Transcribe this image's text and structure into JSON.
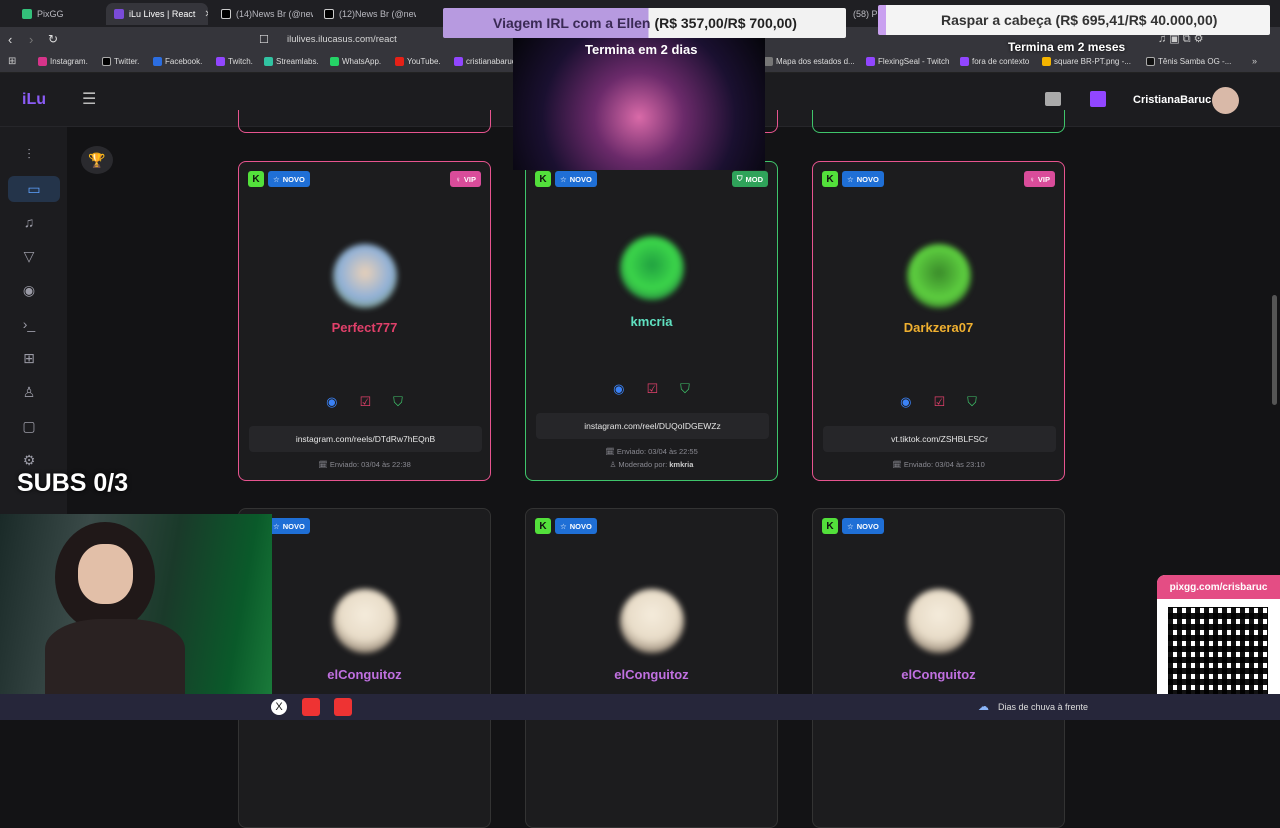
{
  "browser": {
    "tabs": [
      {
        "label": "PixGG",
        "color": "#33c07a"
      },
      {
        "label": "iLu Lives | React",
        "color": "#7a4bd8",
        "active": true
      },
      {
        "label": "(14)News Br (@new",
        "color": "#111"
      },
      {
        "label": "(12)News Br (@new",
        "color": "#111"
      },
      {
        "label": "(58) Pi",
        "color": "#c33"
      }
    ],
    "url": "ilulives.ilucasus.com/react",
    "bookmarks": [
      {
        "label": "Instagram.",
        "color": "#d6348a"
      },
      {
        "label": "Twitter.",
        "color": "#000"
      },
      {
        "label": "Facebook.",
        "color": "#2b6de0"
      },
      {
        "label": "Twitch.",
        "color": "#9146ff"
      },
      {
        "label": "Streamlabs.",
        "color": "#31c3a2"
      },
      {
        "label": "WhatsApp.",
        "color": "#25d366"
      },
      {
        "label": "YouTube.",
        "color": "#e62117"
      },
      {
        "label": "cristianabaruc",
        "color": "#9146ff"
      },
      {
        "label": "Mapa dos estados d...",
        "color": "#777"
      },
      {
        "label": "FlexingSeal - Twitch",
        "color": "#9146ff"
      },
      {
        "label": "fora de contexto",
        "color": "#9146ff"
      },
      {
        "label": "square BR-PT.png -...",
        "color": "#f4b400"
      },
      {
        "label": "Tênis Samba OG -...",
        "color": "#111"
      }
    ]
  },
  "app": {
    "logo": "iLu",
    "username": "CristianaBaruc"
  },
  "cards": [
    {
      "user": "Perfect777",
      "name_color": "#e0406a",
      "border": "pink",
      "tag": "VIP",
      "tag_color": "#d94c9a",
      "new": "NOVO",
      "link": "instagram.com/reels/DTdRw7hEQnB",
      "sent": "Enviado: 03/04 às 22:38",
      "avatar": "#8fb0d8"
    },
    {
      "user": "kmcria",
      "name_color": "#5fe0c0",
      "border": "green",
      "tag": "MOD",
      "tag_color": "#2fa35a",
      "new": "NOVO",
      "link": "instagram.com/reel/DUQoIDGEWZz",
      "sent": "Enviado: 03/04 às 22:55",
      "moderated_label": "Moderado por:",
      "moderated_by": "kmkria",
      "avatar": "#3cd64a"
    },
    {
      "user": "Darkzera07",
      "name_color": "#f0b030",
      "border": "pink",
      "tag": "VIP",
      "tag_color": "#d94c9a",
      "new": "NOVO",
      "link": "vt.tiktok.com/ZSHBLFSCr",
      "sent": "Enviado: 03/04 às 23:10",
      "avatar": "#5ed040"
    },
    {
      "user": "elConguitoz",
      "name_color": "#c070e0",
      "new": "NOVO",
      "avatar": "#e8dcc8"
    },
    {
      "user": "elConguitoz",
      "name_color": "#c070e0",
      "new": "NOVO",
      "avatar": "#e8dcc8"
    },
    {
      "user": "elConguitoz",
      "name_color": "#c070e0",
      "new": "NOVO",
      "avatar": "#e8dcc8"
    }
  ],
  "overlay": {
    "goal1": {
      "title": "Viagem IRL com a Ellen",
      "amount": "(R$ 357,00/R$ 700,00)",
      "ends": "Termina em 2 dias"
    },
    "goal2": {
      "title": "Raspar a cabeça",
      "amount": "(R$ 695,41/R$ 40.000,00)",
      "ends": "Termina em 2 meses"
    },
    "subs": "SUBS 0/3",
    "pix_url": "pixgg.com/crisbaruc",
    "weather": "Dias de chuva à frente"
  }
}
